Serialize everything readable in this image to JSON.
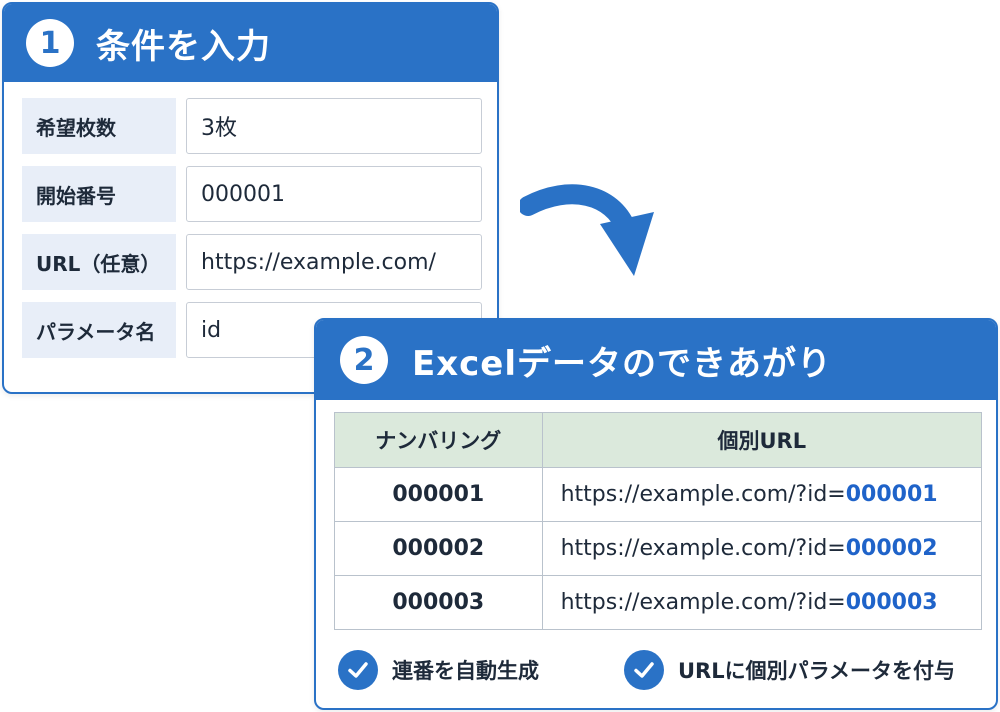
{
  "step1": {
    "number": "1",
    "title": "条件を入力",
    "fields": [
      {
        "label": "希望枚数",
        "value": "3枚"
      },
      {
        "label": "開始番号",
        "value": "000001"
      },
      {
        "label": "URL（任意）",
        "value": "https://example.com/"
      },
      {
        "label": "パラメータ名",
        "value": "id"
      }
    ]
  },
  "step2": {
    "number": "2",
    "title": "Excelデータのできあがり",
    "table": {
      "headers": [
        "ナンバリング",
        "個別URL"
      ],
      "rows": [
        {
          "number": "000001",
          "url_base": "https://example.com/?id=",
          "url_id": "000001"
        },
        {
          "number": "000002",
          "url_base": "https://example.com/?id=",
          "url_id": "000002"
        },
        {
          "number": "000003",
          "url_base": "https://example.com/?id=",
          "url_id": "000003"
        }
      ]
    },
    "features": [
      "連番を自動生成",
      "URLに個別パラメータを付与"
    ]
  },
  "colors": {
    "accent": "#2a72c6",
    "number_text": "#1f63c9",
    "header_bg": "#dbe9dc",
    "label_bg": "#e8eef8"
  },
  "icons": [
    "curved-arrow-icon",
    "check-icon"
  ]
}
